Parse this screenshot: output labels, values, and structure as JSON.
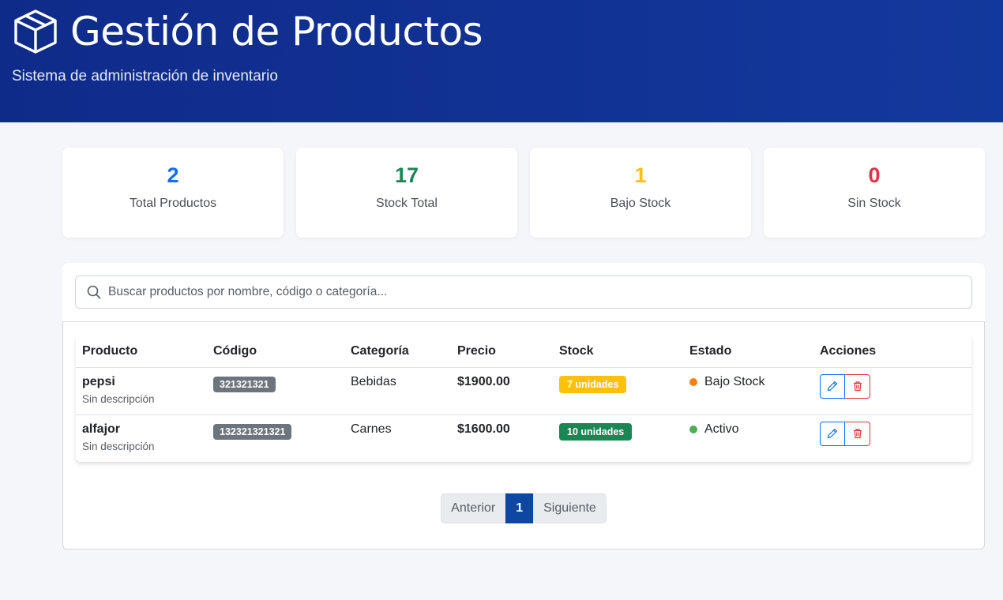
{
  "header": {
    "title": "Gestión de Productos",
    "subtitle": "Sistema de administración de inventario",
    "icon": "box-icon"
  },
  "stats": [
    {
      "value": "2",
      "label": "Total Productos",
      "color": "#0d6efd"
    },
    {
      "value": "17",
      "label": "Stock Total",
      "color": "#198754"
    },
    {
      "value": "1",
      "label": "Bajo Stock",
      "color": "#ffc107"
    },
    {
      "value": "0",
      "label": "Sin Stock",
      "color": "#dc3545"
    }
  ],
  "search": {
    "placeholder": "Buscar productos por nombre, código o categoría...",
    "value": ""
  },
  "table": {
    "headers": [
      "Producto",
      "Código",
      "Categoría",
      "Precio",
      "Stock",
      "Estado",
      "Acciones"
    ],
    "rows": [
      {
        "name": "pepsi",
        "description": "Sin descripción",
        "code": "321321321",
        "category": "Bebidas",
        "price": "$1900.00",
        "stock": "7 unidades",
        "stock_color": "#ffc107",
        "status": "Bajo Stock",
        "status_color": "#fd7e14"
      },
      {
        "name": "alfajor",
        "description": "Sin descripción",
        "code": "132321321321",
        "category": "Carnes",
        "price": "$1600.00",
        "stock": "10 unidades",
        "stock_color": "#198754",
        "status": "Activo",
        "status_color": "#4caf50"
      }
    ]
  },
  "pagination": {
    "prev": "Anterior",
    "current": "1",
    "next": "Siguiente"
  }
}
